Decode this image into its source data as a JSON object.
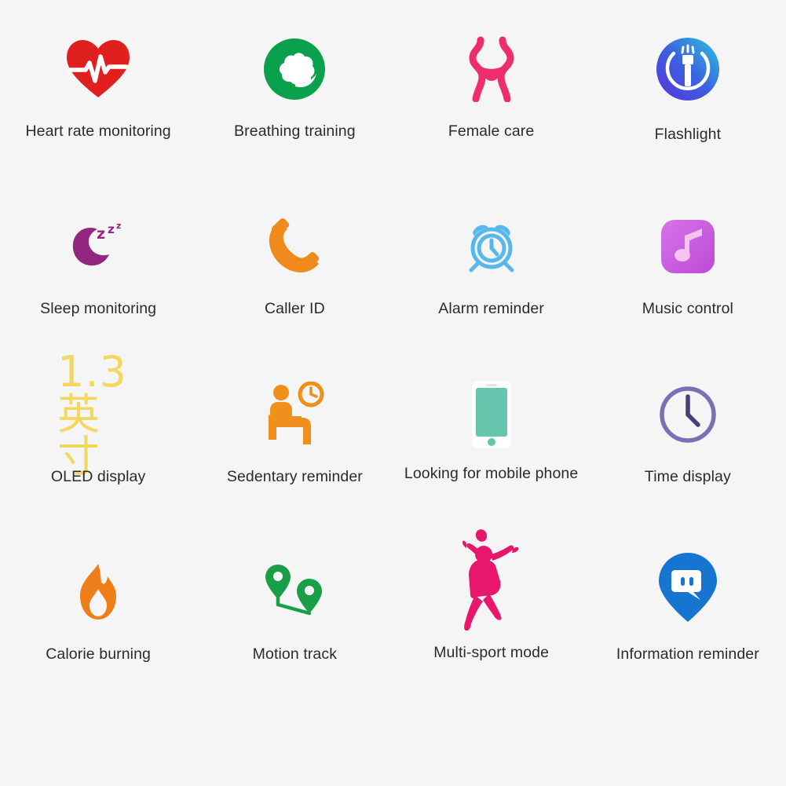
{
  "page": {
    "background_color": "#f5f5f5",
    "label_color": "#2b2b2b",
    "columns": 4,
    "rows": 4
  },
  "features": [
    {
      "id": "heart-rate-monitoring",
      "label": "Heart rate monitoring",
      "icon": "heart-rate-icon",
      "color": "#e0201f",
      "accent": "#ffffff"
    },
    {
      "id": "breathing-training",
      "label": "Breathing training",
      "icon": "breathing-lung-icon",
      "color": "#0ba04b",
      "accent": "#ffffff"
    },
    {
      "id": "female-care",
      "label": "Female care",
      "icon": "female-body-icon",
      "color": "#ef2d6b",
      "accent": "#f5f5f5"
    },
    {
      "id": "flashlight",
      "label": "Flashlight",
      "icon": "flashlight-icon",
      "color": "#4b3ce0",
      "accent": "#2ec4dd"
    },
    {
      "id": "sleep-monitoring",
      "label": "Sleep monitoring",
      "icon": "moon-zzz-icon",
      "color": "#93277f",
      "accent": "#93277f"
    },
    {
      "id": "caller-id",
      "label": "Caller ID",
      "icon": "phone-handset-icon",
      "color": "#f08a1c",
      "accent": "#f5a623"
    },
    {
      "id": "alarm-reminder",
      "label": "Alarm reminder",
      "icon": "alarm-clock-icon",
      "color": "#56b9ea",
      "accent": "#56b9ea"
    },
    {
      "id": "music-control",
      "label": "Music control",
      "icon": "music-note-icon",
      "color": "#c963e0",
      "accent": "#f3b8ec"
    },
    {
      "id": "oled-display",
      "label": "OLED display",
      "icon": "oled-size-text",
      "icon_text": "1.3英寸",
      "color": "#f2d85e",
      "accent": "#f7e79a"
    },
    {
      "id": "sedentary-reminder",
      "label": "Sedentary reminder",
      "icon": "seated-person-clock-icon",
      "color": "#ef8f1c",
      "accent": "#ef8f1c"
    },
    {
      "id": "looking-for-mobile-phone",
      "label": "Looking for mobile phone",
      "icon": "mobile-phone-icon",
      "color": "#67c4ad",
      "accent": "#ffffff"
    },
    {
      "id": "time-display",
      "label": "Time display",
      "icon": "clock-icon",
      "color": "#7b6fb5",
      "accent": "#7b6fb5"
    },
    {
      "id": "calorie-burning",
      "label": "Calorie burning",
      "icon": "flame-icon",
      "color": "#f07e18",
      "accent": "#f5f5f5"
    },
    {
      "id": "motion-track",
      "label": "Motion track",
      "icon": "map-pins-route-icon",
      "color": "#1a9e47",
      "accent": "#f5f5f5"
    },
    {
      "id": "multi-sport-mode",
      "label": "Multi-sport mode",
      "icon": "athlete-silhouette-icon",
      "color": "#e8176b",
      "accent": "#e8176b"
    },
    {
      "id": "information-reminder",
      "label": "Information reminder",
      "icon": "message-pin-icon",
      "color": "#1675d1",
      "accent": "#ffffff"
    }
  ]
}
